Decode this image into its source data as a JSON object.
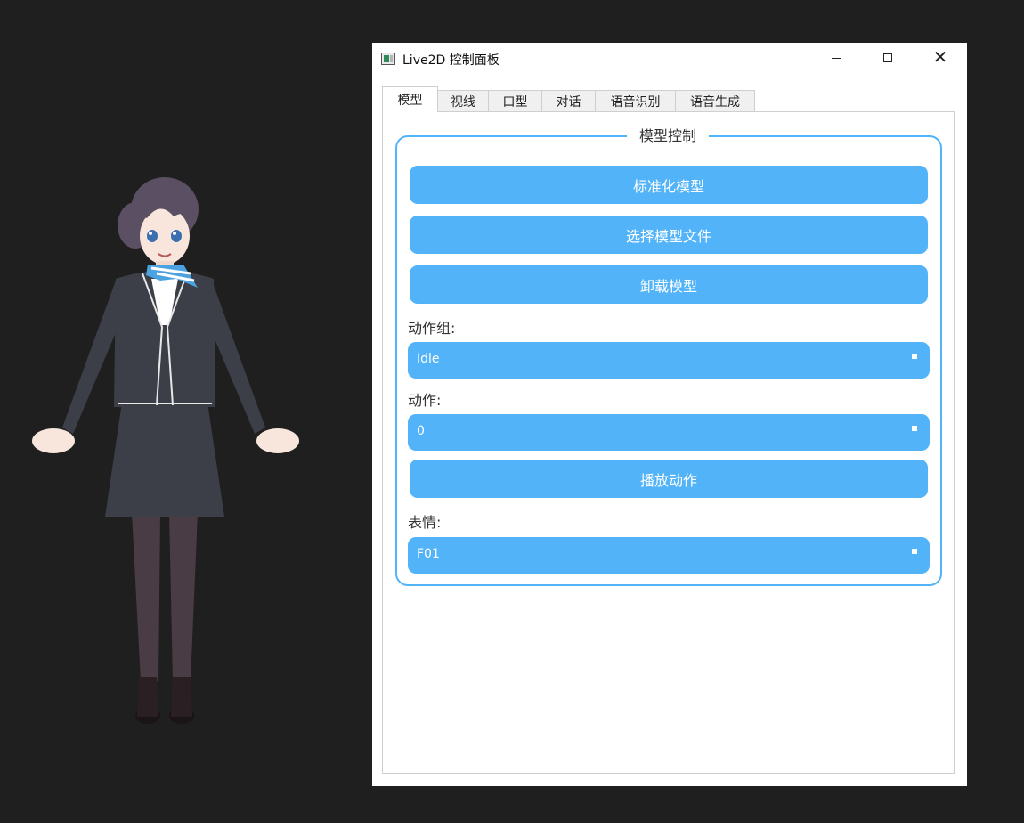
{
  "window": {
    "title": "Live2D 控制面板"
  },
  "tabs": [
    "模型",
    "视线",
    "口型",
    "对话",
    "语音识别",
    "语音生成"
  ],
  "group": {
    "title": "模型控制",
    "normalize_button": "标准化模型",
    "select_file_button": "选择模型文件",
    "unload_button": "卸载模型",
    "motion_group_label": "动作组:",
    "motion_group_value": "Idle",
    "motion_label": "动作:",
    "motion_value": "0",
    "play_button": "播放动作",
    "expression_label": "表情:",
    "expression_value": "F01"
  },
  "colors": {
    "accent": "#52b3f8",
    "desktop": "#1f1f1f",
    "jacket": "#3c3f47",
    "hair": "#5a4f63",
    "scarf": "#4aa3e0"
  },
  "icons": {
    "app": "window-app-icon",
    "minimize": "minimize-icon",
    "maximize": "maximize-icon",
    "close": "close-icon"
  }
}
